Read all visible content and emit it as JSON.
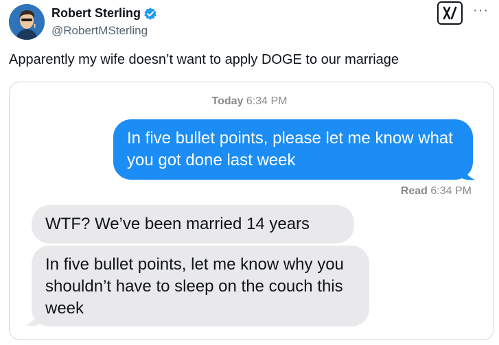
{
  "post": {
    "author_name": "Robert Sterling",
    "author_handle": "@RobertMSterling",
    "more_label": "···",
    "text": "Apparently my wife doesn’t want to apply DOGE to our marriage"
  },
  "icons": {
    "avatar": "avatar-cartoon",
    "verified": "verified-badge-icon",
    "logo": "grok-logo-icon",
    "more": "more-options-icon"
  },
  "colors": {
    "sent_bubble": "#1b8df5",
    "received_bubble": "#e9e9eb",
    "verified": "#1d9bf0",
    "muted": "#8a8a8e"
  },
  "conversation": {
    "header_day": "Today",
    "header_time": "6:34 PM",
    "sent_message": "In five bullet points, please let me know what you got done last week",
    "read_label": "Read",
    "read_time": "6:34 PM",
    "received_messages": [
      "WTF? We’ve been married 14 years",
      "In five bullet points, let me know why you shouldn’t have to sleep on the couch this week"
    ]
  }
}
